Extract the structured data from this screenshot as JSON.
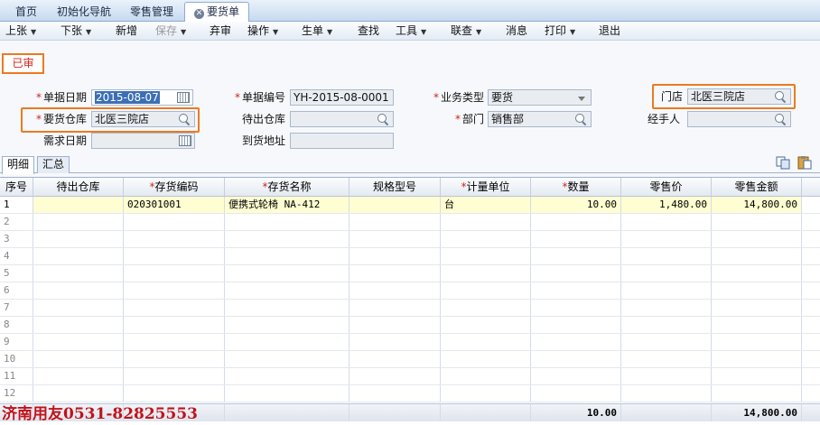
{
  "tabs": [
    {
      "label": "首页"
    },
    {
      "label": "初始化导航"
    },
    {
      "label": "零售管理"
    },
    {
      "label": "要货单",
      "active": true
    }
  ],
  "toolbar": {
    "items": [
      {
        "label": "上张",
        "dropdown": true
      },
      {
        "label": "下张",
        "dropdown": true
      },
      {
        "label": "新增"
      },
      {
        "label": "保存",
        "dropdown": true,
        "disabled": true
      },
      {
        "label": "弃审"
      },
      {
        "label": "操作",
        "dropdown": true
      },
      {
        "label": "生单",
        "dropdown": true
      },
      {
        "label": "查找"
      },
      {
        "label": "工具",
        "dropdown": true
      },
      {
        "label": "联查",
        "dropdown": true
      },
      {
        "label": "消息"
      },
      {
        "label": "打印",
        "dropdown": true
      },
      {
        "label": "退出"
      }
    ]
  },
  "status_badge": "已审",
  "form": {
    "doc_date": {
      "label": "单据日期",
      "value": "2015-08-07",
      "required": true
    },
    "doc_no": {
      "label": "单据编号",
      "value": "YH-2015-08-0001",
      "required": true
    },
    "biz_type": {
      "label": "业务类型",
      "value": "要货",
      "required": true
    },
    "store": {
      "label": "门店",
      "value": "北医三院店"
    },
    "req_warehouse": {
      "label": "要货仓库",
      "value": "北医三院店",
      "required": true
    },
    "out_warehouse": {
      "label": "待出仓库",
      "value": ""
    },
    "dept": {
      "label": "部门",
      "value": "销售部",
      "required": true
    },
    "handler": {
      "label": "经手人",
      "value": ""
    },
    "need_date": {
      "label": "需求日期",
      "value": ""
    },
    "arrival_addr": {
      "label": "到货地址",
      "value": ""
    }
  },
  "subtabs": [
    {
      "label": "明细",
      "active": true
    },
    {
      "label": "汇总"
    }
  ],
  "grid": {
    "columns": [
      {
        "label": "序号",
        "required": false
      },
      {
        "label": "待出仓库",
        "required": false
      },
      {
        "label": "存货编码",
        "required": true
      },
      {
        "label": "存货名称",
        "required": true
      },
      {
        "label": "规格型号",
        "required": false
      },
      {
        "label": "计量单位",
        "required": true
      },
      {
        "label": "数量",
        "required": true
      },
      {
        "label": "零售价",
        "required": false
      },
      {
        "label": "零售金额",
        "required": false
      }
    ],
    "rows": [
      [
        "1",
        "",
        "020301001",
        "便携式轮椅 NA-412",
        "",
        "台",
        "10.00",
        "1,480.00",
        "14,800.00"
      ],
      [
        "2",
        "",
        "",
        "",
        "",
        "",
        "",
        "",
        ""
      ],
      [
        "3",
        "",
        "",
        "",
        "",
        "",
        "",
        "",
        ""
      ],
      [
        "4",
        "",
        "",
        "",
        "",
        "",
        "",
        "",
        ""
      ],
      [
        "5",
        "",
        "",
        "",
        "",
        "",
        "",
        "",
        ""
      ],
      [
        "6",
        "",
        "",
        "",
        "",
        "",
        "",
        "",
        ""
      ],
      [
        "7",
        "",
        "",
        "",
        "",
        "",
        "",
        "",
        ""
      ],
      [
        "8",
        "",
        "",
        "",
        "",
        "",
        "",
        "",
        ""
      ],
      [
        "9",
        "",
        "",
        "",
        "",
        "",
        "",
        "",
        ""
      ],
      [
        "10",
        "",
        "",
        "",
        "",
        "",
        "",
        "",
        ""
      ],
      [
        "11",
        "",
        "",
        "",
        "",
        "",
        "",
        "",
        ""
      ],
      [
        "12",
        "",
        "",
        "",
        "",
        "",
        "",
        "",
        ""
      ]
    ],
    "totals": {
      "qty": "10.00",
      "amount": "14,800.00"
    }
  },
  "watermark": "济南用友0531-82825553",
  "colors": {
    "highlight": "#ec7a22",
    "required": "#d4231b",
    "selected_row": "#fefed2"
  }
}
